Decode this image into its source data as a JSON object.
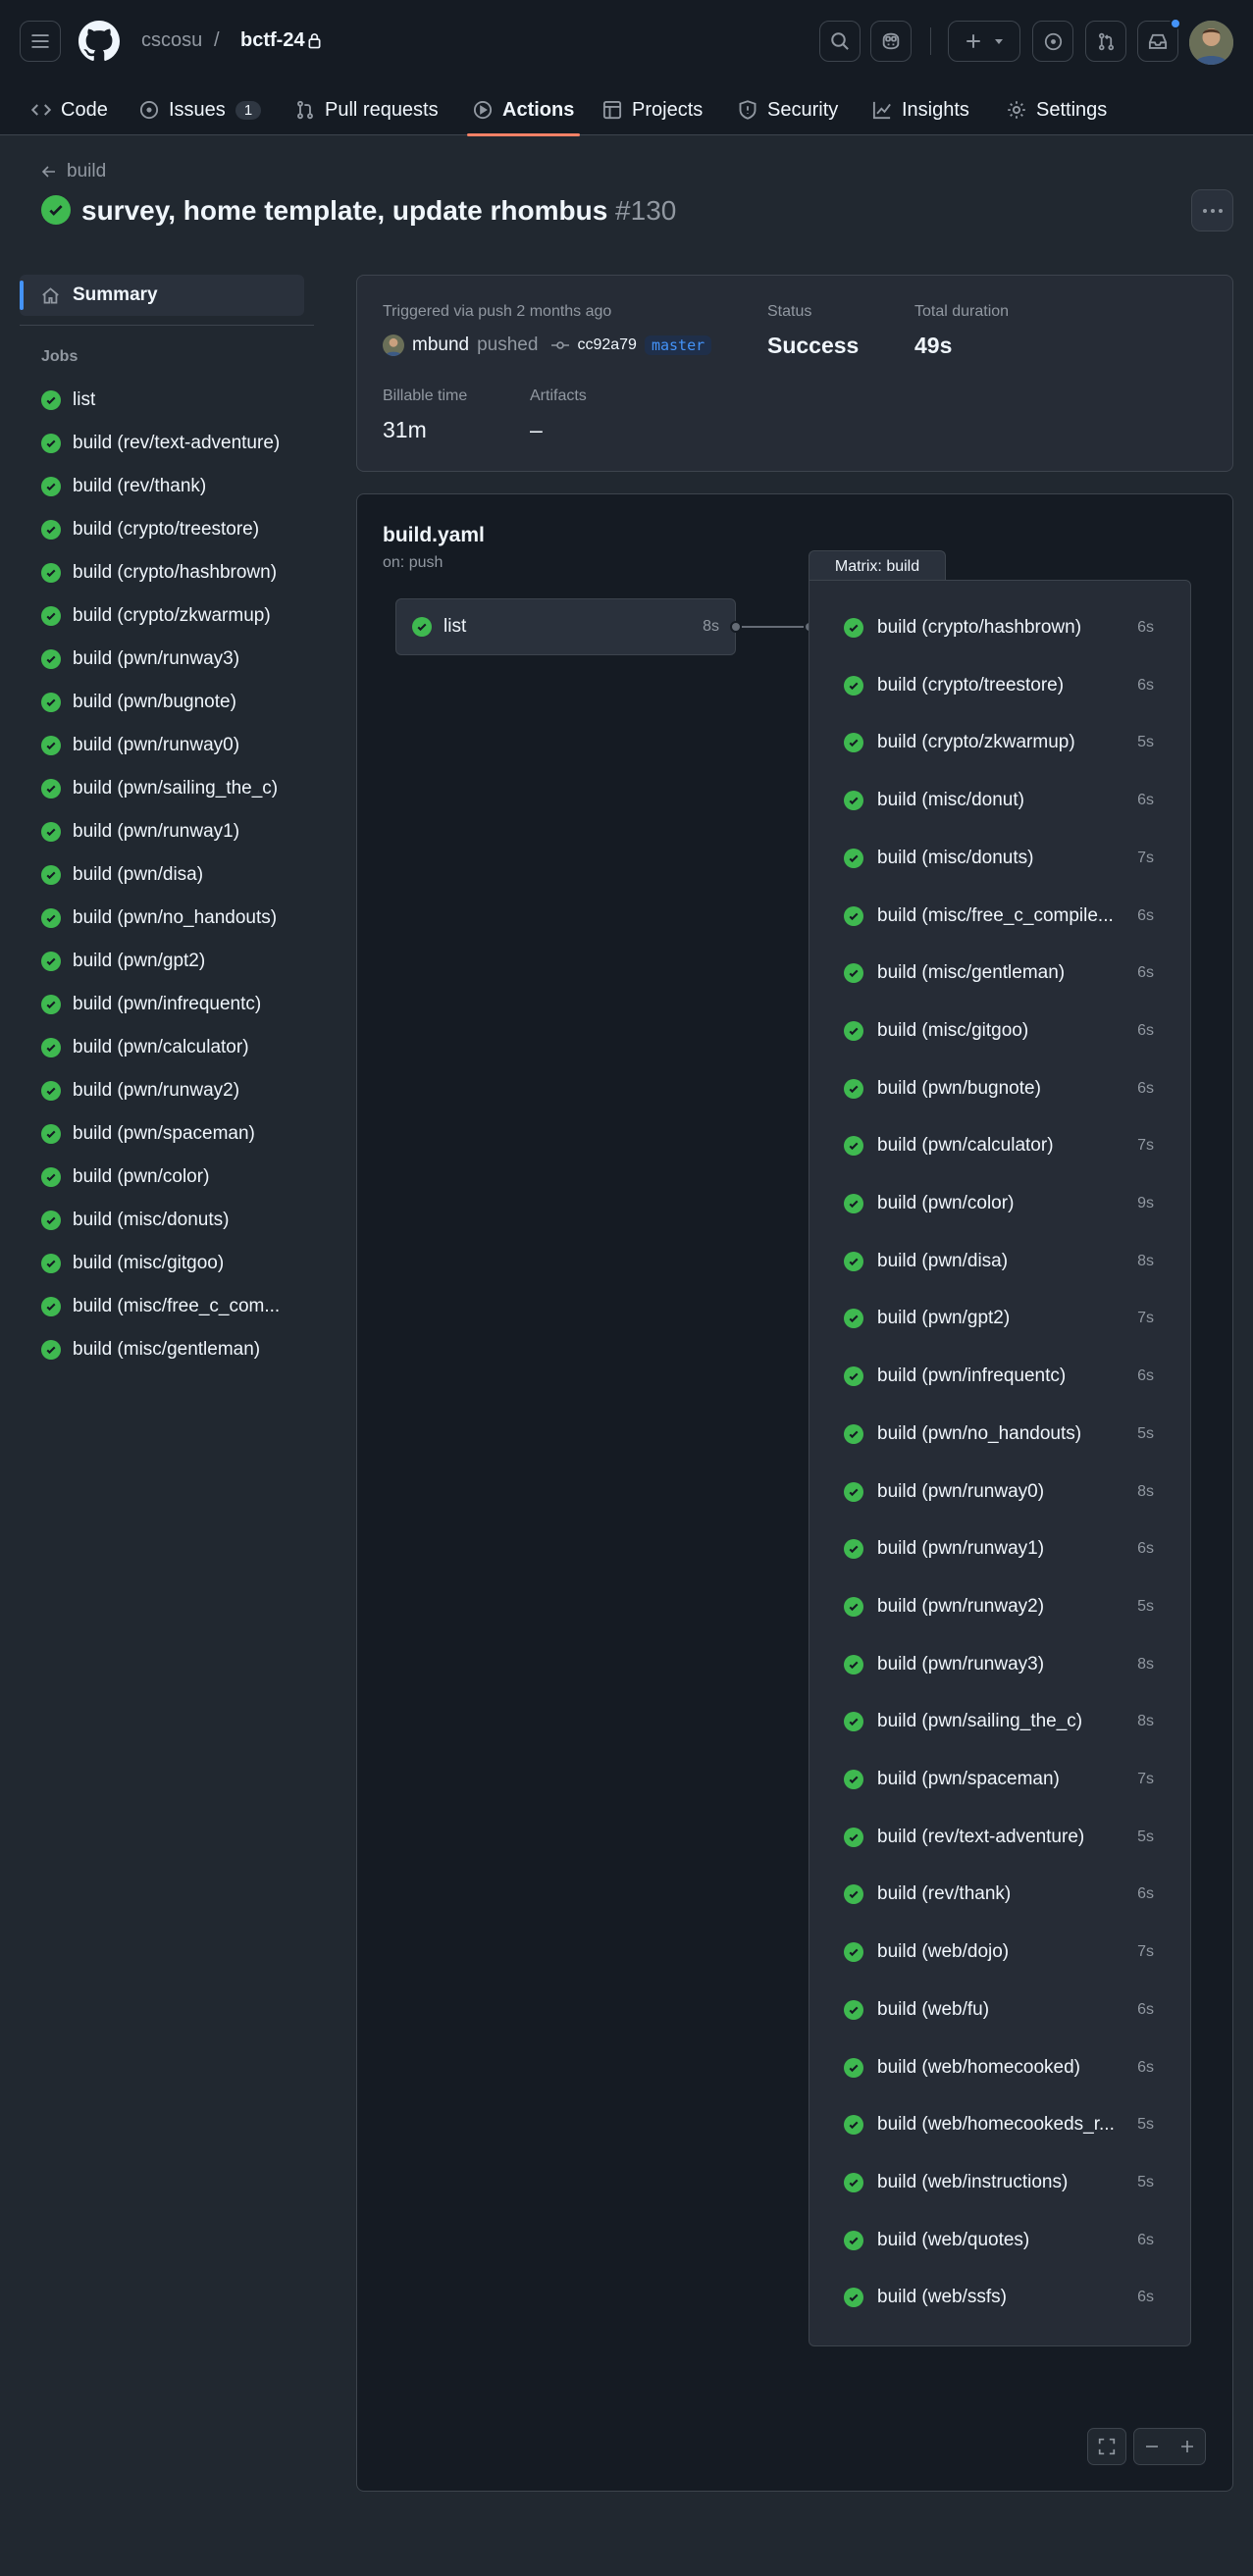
{
  "header": {
    "owner": "cscosu",
    "separator": "/",
    "repo": "bctf-24",
    "notification_dot_color": "#4493f8"
  },
  "tabs": [
    {
      "label": "Code",
      "icon": "code-icon"
    },
    {
      "label": "Issues",
      "count": "1",
      "icon": "issue-opened-icon"
    },
    {
      "label": "Pull requests",
      "icon": "git-pull-request-icon"
    },
    {
      "label": "Actions",
      "icon": "play-icon",
      "selected": true
    },
    {
      "label": "Projects",
      "icon": "table-icon"
    },
    {
      "label": "Security",
      "icon": "shield-icon"
    },
    {
      "label": "Insights",
      "icon": "graph-icon"
    },
    {
      "label": "Settings",
      "icon": "gear-icon"
    }
  ],
  "run": {
    "back_label": "build",
    "title": "survey, home template, update rhombus",
    "number": "#130",
    "status_color": "#3fb950"
  },
  "sidebar": {
    "summary_label": "Summary",
    "jobs_heading": "Jobs",
    "jobs": [
      "list",
      "build (rev/text-adventure)",
      "build (rev/thank)",
      "build (crypto/treestore)",
      "build (crypto/hashbrown)",
      "build (crypto/zkwarmup)",
      "build (pwn/runway3)",
      "build (pwn/bugnote)",
      "build (pwn/runway0)",
      "build (pwn/sailing_the_c)",
      "build (pwn/runway1)",
      "build (pwn/disa)",
      "build (pwn/no_handouts)",
      "build (pwn/gpt2)",
      "build (pwn/infrequentc)",
      "build (pwn/calculator)",
      "build (pwn/runway2)",
      "build (pwn/spaceman)",
      "build (pwn/color)",
      "build (misc/donuts)",
      "build (misc/gitgoo)",
      "build (misc/free_c_com...",
      "build (misc/gentleman)"
    ]
  },
  "summary": {
    "triggered_label": "Triggered via push 2 months ago",
    "actor": "mbund",
    "action": "pushed",
    "commit": "cc92a79",
    "branch": "master",
    "status_label": "Status",
    "status_value": "Success",
    "duration_label": "Total duration",
    "duration_value": "49s",
    "billable_label": "Billable time",
    "billable_value": "31m",
    "artifacts_label": "Artifacts",
    "artifacts_value": "–"
  },
  "workflow": {
    "file": "build.yaml",
    "trigger": "on: push",
    "list_job": {
      "name": "list",
      "duration": "8s"
    },
    "matrix_label": "Matrix: build",
    "matrix_jobs": [
      {
        "name": "build (crypto/hashbrown)",
        "duration": "6s"
      },
      {
        "name": "build (crypto/treestore)",
        "duration": "6s"
      },
      {
        "name": "build (crypto/zkwarmup)",
        "duration": "5s"
      },
      {
        "name": "build (misc/donut)",
        "duration": "6s"
      },
      {
        "name": "build (misc/donuts)",
        "duration": "7s"
      },
      {
        "name": "build (misc/free_c_compile...",
        "duration": "6s"
      },
      {
        "name": "build (misc/gentleman)",
        "duration": "6s"
      },
      {
        "name": "build (misc/gitgoo)",
        "duration": "6s"
      },
      {
        "name": "build (pwn/bugnote)",
        "duration": "6s"
      },
      {
        "name": "build (pwn/calculator)",
        "duration": "7s"
      },
      {
        "name": "build (pwn/color)",
        "duration": "9s"
      },
      {
        "name": "build (pwn/disa)",
        "duration": "8s"
      },
      {
        "name": "build (pwn/gpt2)",
        "duration": "7s"
      },
      {
        "name": "build (pwn/infrequentc)",
        "duration": "6s"
      },
      {
        "name": "build (pwn/no_handouts)",
        "duration": "5s"
      },
      {
        "name": "build (pwn/runway0)",
        "duration": "8s"
      },
      {
        "name": "build (pwn/runway1)",
        "duration": "6s"
      },
      {
        "name": "build (pwn/runway2)",
        "duration": "5s"
      },
      {
        "name": "build (pwn/runway3)",
        "duration": "8s"
      },
      {
        "name": "build (pwn/sailing_the_c)",
        "duration": "8s"
      },
      {
        "name": "build (pwn/spaceman)",
        "duration": "7s"
      },
      {
        "name": "build (rev/text-adventure)",
        "duration": "5s"
      },
      {
        "name": "build (rev/thank)",
        "duration": "6s"
      },
      {
        "name": "build (web/dojo)",
        "duration": "7s"
      },
      {
        "name": "build (web/fu)",
        "duration": "6s"
      },
      {
        "name": "build (web/homecooked)",
        "duration": "6s"
      },
      {
        "name": "build (web/homecookeds_r...",
        "duration": "5s"
      },
      {
        "name": "build (web/instructions)",
        "duration": "5s"
      },
      {
        "name": "build (web/quotes)",
        "duration": "6s"
      },
      {
        "name": "build (web/ssfs)",
        "duration": "6s"
      }
    ]
  },
  "graph_controls": {
    "fullscreen_icon": "screen-full-icon",
    "zoom_out_icon": "dash-icon",
    "zoom_in_icon": "plus-icon"
  }
}
